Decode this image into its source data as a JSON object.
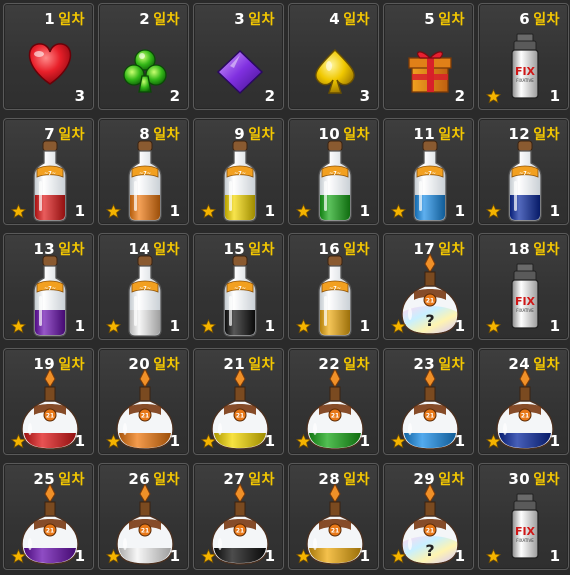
{
  "day_suffix": "일차",
  "colors": {
    "red": "#e01818",
    "orange": "#f07a10",
    "yellow": "#f5d800",
    "green": "#18a818",
    "blue": "#1a8ee8",
    "navy": "#0a2aa0",
    "purple": "#6a10b0",
    "white": "#f4f4f4",
    "black": "#101010",
    "gold": "#f0ac10",
    "star": "#f5b400",
    "suffix": "#f5c800"
  },
  "rewards": [
    {
      "day": "1",
      "icon": "heart-icon",
      "qty": "3",
      "star": false
    },
    {
      "day": "2",
      "icon": "club-icon",
      "qty": "2",
      "star": false
    },
    {
      "day": "3",
      "icon": "diamond-icon",
      "qty": "2",
      "star": false
    },
    {
      "day": "4",
      "icon": "spade-icon",
      "qty": "3",
      "star": false
    },
    {
      "day": "5",
      "icon": "gift-box-icon",
      "qty": "2",
      "star": false
    },
    {
      "day": "6",
      "icon": "fix-spray-can-icon",
      "can_label": "FIX",
      "can_sublabel": "FIXATIVE",
      "qty": "1",
      "star": true
    },
    {
      "day": "7",
      "icon": "dye-bottle-icon",
      "color": "red",
      "bottle_label": "~7~",
      "qty": "1",
      "star": true
    },
    {
      "day": "8",
      "icon": "dye-bottle-icon",
      "color": "orange",
      "bottle_label": "~7~",
      "qty": "1",
      "star": true
    },
    {
      "day": "9",
      "icon": "dye-bottle-icon",
      "color": "yellow",
      "bottle_label": "~7~",
      "qty": "1",
      "star": true
    },
    {
      "day": "10",
      "icon": "dye-bottle-icon",
      "color": "green",
      "bottle_label": "~7~",
      "qty": "1",
      "star": true
    },
    {
      "day": "11",
      "icon": "dye-bottle-icon",
      "color": "blue",
      "bottle_label": "~7~",
      "qty": "1",
      "star": true
    },
    {
      "day": "12",
      "icon": "dye-bottle-icon",
      "color": "navy",
      "bottle_label": "~7~",
      "qty": "1",
      "star": true
    },
    {
      "day": "13",
      "icon": "dye-bottle-icon",
      "color": "purple",
      "bottle_label": "~7~",
      "qty": "1",
      "star": true
    },
    {
      "day": "14",
      "icon": "dye-bottle-icon",
      "color": "white",
      "bottle_label": "~7~",
      "qty": "1",
      "star": true
    },
    {
      "day": "15",
      "icon": "dye-bottle-icon",
      "color": "black",
      "bottle_label": "~7~",
      "qty": "1",
      "star": true
    },
    {
      "day": "16",
      "icon": "dye-bottle-icon",
      "color": "gold",
      "bottle_label": "~7~",
      "qty": "1",
      "star": true
    },
    {
      "day": "17",
      "icon": "mystery-dye-flask-icon",
      "flask_label": "21",
      "qty": "1",
      "star": true
    },
    {
      "day": "18",
      "icon": "fix-spray-can-icon",
      "can_label": "FIX",
      "can_sublabel": "FIXATIVE",
      "qty": "1",
      "star": true
    },
    {
      "day": "19",
      "icon": "dye-flask-icon",
      "color": "red",
      "flask_label": "21",
      "qty": "1",
      "star": true
    },
    {
      "day": "20",
      "icon": "dye-flask-icon",
      "color": "orange",
      "flask_label": "21",
      "qty": "1",
      "star": true
    },
    {
      "day": "21",
      "icon": "dye-flask-icon",
      "color": "yellow",
      "flask_label": "21",
      "qty": "1",
      "star": true
    },
    {
      "day": "22",
      "icon": "dye-flask-icon",
      "color": "green",
      "flask_label": "21",
      "qty": "1",
      "star": true
    },
    {
      "day": "23",
      "icon": "dye-flask-icon",
      "color": "blue",
      "flask_label": "21",
      "qty": "1",
      "star": true
    },
    {
      "day": "24",
      "icon": "dye-flask-icon",
      "color": "navy",
      "flask_label": "21",
      "qty": "1",
      "star": true
    },
    {
      "day": "25",
      "icon": "dye-flask-icon",
      "color": "purple",
      "flask_label": "21",
      "qty": "1",
      "star": true
    },
    {
      "day": "26",
      "icon": "dye-flask-icon",
      "color": "white",
      "flask_label": "21",
      "qty": "1",
      "star": true
    },
    {
      "day": "27",
      "icon": "dye-flask-icon",
      "color": "black",
      "flask_label": "21",
      "qty": "1",
      "star": true
    },
    {
      "day": "28",
      "icon": "dye-flask-icon",
      "color": "gold",
      "flask_label": "21",
      "qty": "1",
      "star": true
    },
    {
      "day": "29",
      "icon": "mystery-dye-flask-icon",
      "flask_label": "21",
      "qty": "1",
      "star": true
    },
    {
      "day": "30",
      "icon": "fix-spray-can-icon",
      "can_label": "FIX",
      "can_sublabel": "FIXATIVE",
      "qty": "1",
      "star": true
    }
  ]
}
